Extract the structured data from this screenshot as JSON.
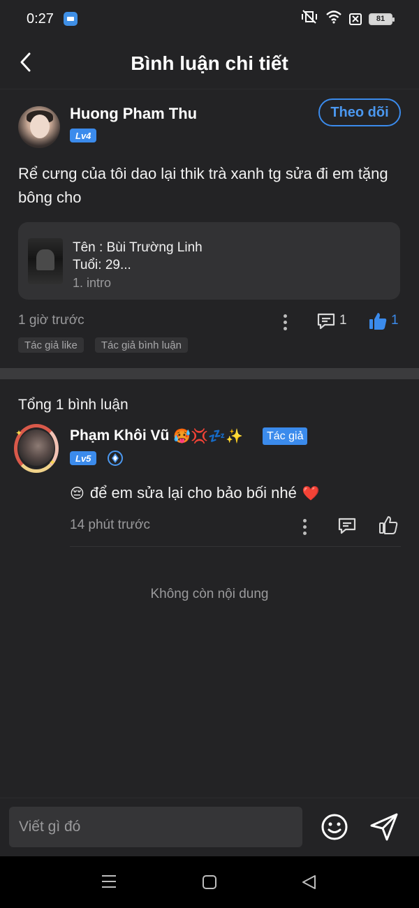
{
  "status_bar": {
    "time": "0:27",
    "app_icon": "NOVEL TOON",
    "battery": "81"
  },
  "header": {
    "title": "Bình luận chi tiết"
  },
  "post": {
    "author_name": "Huong Pham Thu",
    "author_level": "Lv4",
    "follow_label": "Theo dõi",
    "text": "Rể cưng của tôi dao lại thik trà xanh tg sửa đi em tặng bông cho",
    "book": {
      "title": "Tên : Bùi Trường Linh\nTuổi: 29...",
      "chapter": "1. intro"
    },
    "time_ago": "1 giờ trước",
    "reply_count": "1",
    "like_count": "1",
    "tags": [
      "Tác giả like",
      "Tác giả bình luận"
    ]
  },
  "comments": {
    "total_label": "Tổng 1 bình luận",
    "items": [
      {
        "name": "Phạm Khôi Vũ",
        "name_emojis": "🥵💢💤✨",
        "author_tag": "Tác giả",
        "level": "Lv5",
        "text": "để em sửa lại cho bảo bối nhé",
        "text_prefix_emoji": "😔",
        "text_suffix_emoji": "❤️",
        "time_ago": "14 phút trước"
      }
    ],
    "end_label": "Không còn nội dung"
  },
  "input": {
    "placeholder": "Viết gì đó"
  },
  "colors": {
    "background": "#232325",
    "accent": "#3b8bec",
    "muted_text": "#9a9a9c"
  }
}
